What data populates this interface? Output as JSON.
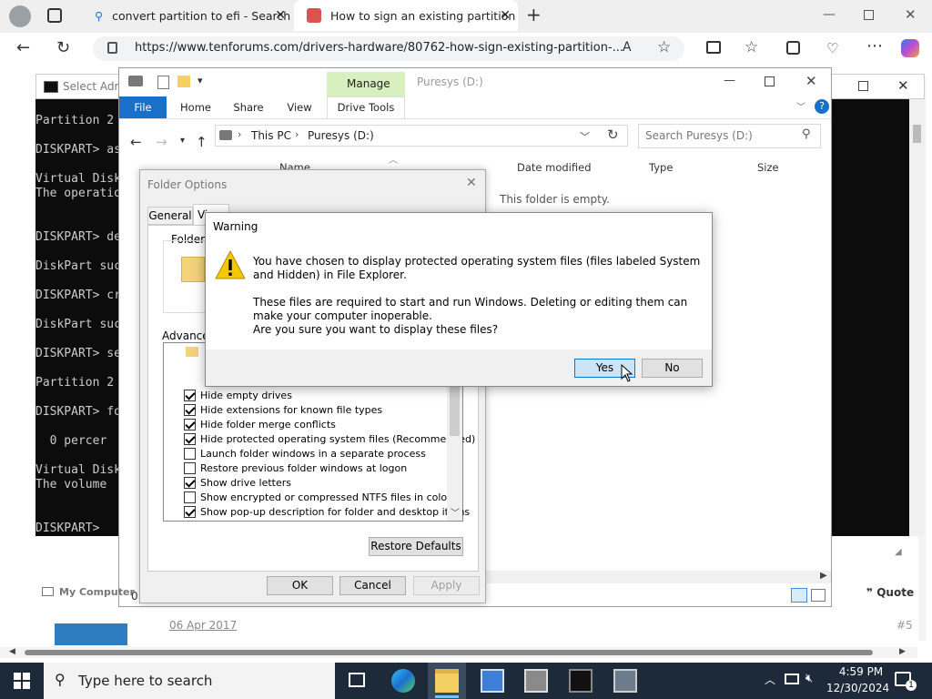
{
  "browser": {
    "tabs": [
      {
        "title": "convert partition to efi - Search"
      },
      {
        "title": "How to sign an existing partition"
      }
    ],
    "url": "https://www.tenforums.com/drivers-hardware/80762-how-sign-existing-partition-..."
  },
  "console": {
    "title": "Select Adm",
    "lines": [
      "Partition 2",
      "DISKPART> as",
      "Virtual Disk",
      "The operatio",
      "DISKPART> de",
      "DiskPart suc",
      "DISKPART> cr",
      "DiskPart suc",
      "DISKPART> se",
      "Partition 2",
      "DISKPART> fo",
      "  0 percer",
      "Virtual Disk",
      "The volume",
      "DISKPART>"
    ]
  },
  "explorer": {
    "title": "Puresys (D:)",
    "manage_tab": "Manage",
    "ribbon_tabs": [
      "File",
      "Home",
      "Share",
      "View",
      "Drive Tools"
    ],
    "breadcrumb": [
      "This PC",
      "Puresys (D:)"
    ],
    "search_placeholder": "Search Puresys (D:)",
    "columns": [
      "Name",
      "Date modified",
      "Type",
      "Size"
    ],
    "empty_message": "This folder is empty."
  },
  "folder_options": {
    "title": "Folder Options",
    "tabs": [
      "General",
      "View",
      "Search"
    ],
    "folder_views_label": "Folder v",
    "advanced_label": "Advanced",
    "settings": [
      {
        "label": "Hide empty drives",
        "checked": true
      },
      {
        "label": "Hide extensions for known file types",
        "checked": true
      },
      {
        "label": "Hide folder merge conflicts",
        "checked": true
      },
      {
        "label": "Hide protected operating system files (Recommended)",
        "checked": true
      },
      {
        "label": "Launch folder windows in a separate process",
        "checked": false
      },
      {
        "label": "Restore previous folder windows at logon",
        "checked": false
      },
      {
        "label": "Show drive letters",
        "checked": true
      },
      {
        "label": "Show encrypted or compressed NTFS files in color",
        "checked": false
      },
      {
        "label": "Show pop-up description for folder and desktop items",
        "checked": true
      }
    ],
    "restore_defaults": "Restore Defaults",
    "ok": "OK",
    "cancel": "Cancel",
    "apply": "Apply"
  },
  "warning": {
    "title": "Warning",
    "line1": "You have chosen to display protected operating system files (files labeled System and Hidden) in File Explorer.",
    "line2": "These files are required to start and run Windows. Deleting or editing them can make your computer inoperable.",
    "line3": "Are you sure you want to display these files?",
    "yes": "Yes",
    "no": "No"
  },
  "webpage": {
    "my_computer": "My Computer",
    "quote": "Quote",
    "post_date": "06 Apr 2017",
    "post_number": "#5",
    "zero": "0"
  },
  "taskbar": {
    "search_placeholder": "Type here to search",
    "time": "4:59 PM",
    "date": "12/30/2024",
    "notification_count": "1"
  }
}
